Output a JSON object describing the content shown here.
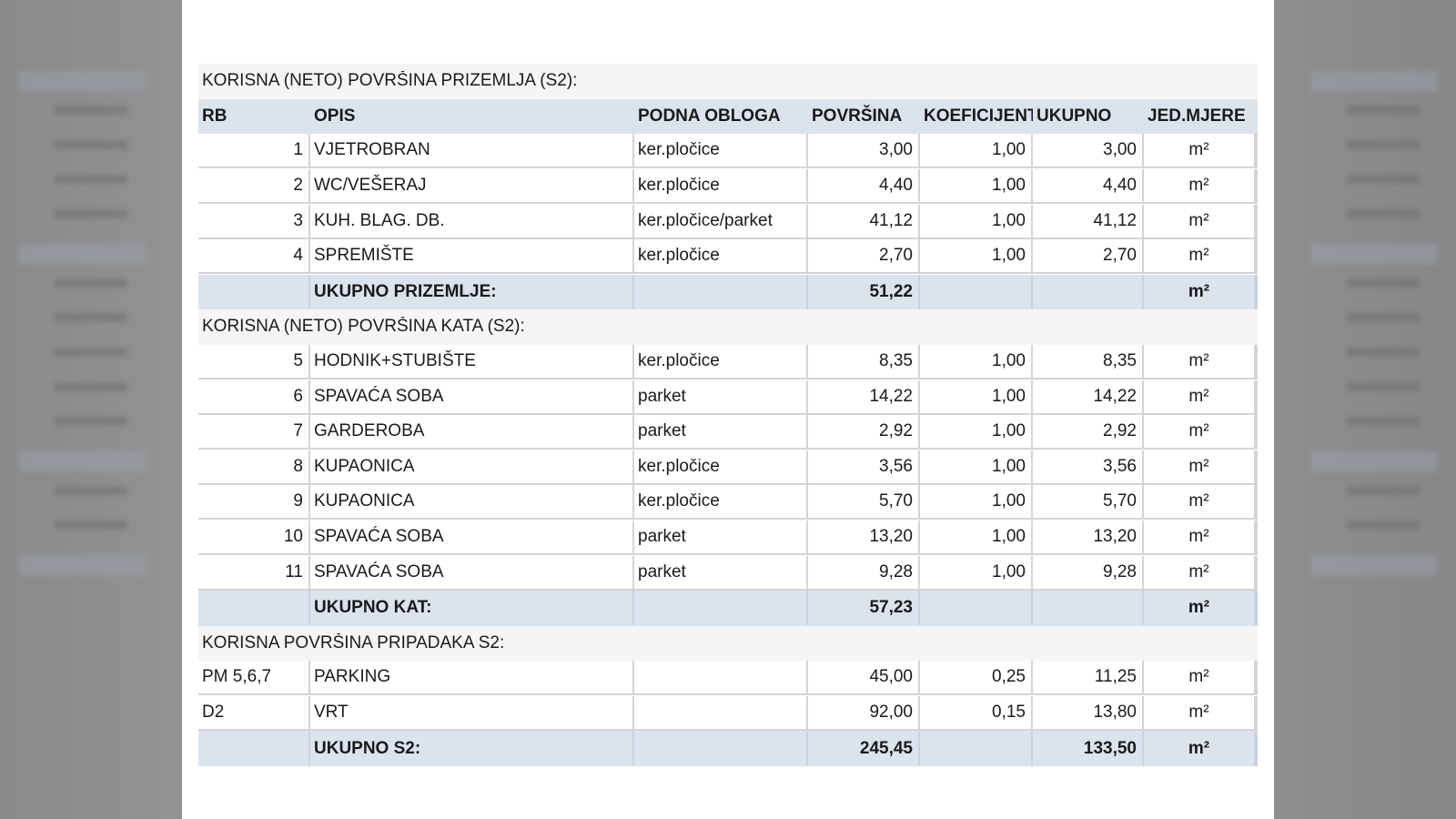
{
  "header": [
    "RB",
    "OPIS",
    "PODNA OBLOGA",
    "POVRŠINA",
    "KOEFICIJENT",
    "UKUPNO",
    "JED.MJERE"
  ],
  "unit": "m²",
  "sections": [
    {
      "title": "KORISNA (NETO) POVRŠINA PRIZEMLJA (S2):",
      "rows": [
        {
          "rb": "1",
          "opis": "VJETROBRAN",
          "obloga": "ker.pločice",
          "povrsina": "3,00",
          "koef": "1,00",
          "ukupno": "3,00"
        },
        {
          "rb": "2",
          "opis": "WC/VEŠERAJ",
          "obloga": "ker.pločice",
          "povrsina": "4,40",
          "koef": "1,00",
          "ukupno": "4,40"
        },
        {
          "rb": "3",
          "opis": "KUH. BLAG. DB.",
          "obloga": "ker.pločice/parket",
          "povrsina": "41,12",
          "koef": "1,00",
          "ukupno": "41,12"
        },
        {
          "rb": "4",
          "opis": "SPREMIŠTE",
          "obloga": "ker.pločice",
          "povrsina": "2,70",
          "koef": "1,00",
          "ukupno": "2,70"
        }
      ],
      "total": {
        "label": "UKUPNO PRIZEMLJE:",
        "povrsina": "51,22",
        "ukupno": ""
      }
    },
    {
      "title": "KORISNA (NETO) POVRŠINA KATA (S2):",
      "rows": [
        {
          "rb": "5",
          "opis": "HODNIK+STUBIŠTE",
          "obloga": "ker.pločice",
          "povrsina": "8,35",
          "koef": "1,00",
          "ukupno": "8,35"
        },
        {
          "rb": "6",
          "opis": "SPAVAĆA SOBA",
          "obloga": "parket",
          "povrsina": "14,22",
          "koef": "1,00",
          "ukupno": "14,22"
        },
        {
          "rb": "7",
          "opis": "GARDEROBA",
          "obloga": "parket",
          "povrsina": "2,92",
          "koef": "1,00",
          "ukupno": "2,92"
        },
        {
          "rb": "8",
          "opis": "KUPAONICA",
          "obloga": "ker.pločice",
          "povrsina": "3,56",
          "koef": "1,00",
          "ukupno": "3,56"
        },
        {
          "rb": "9",
          "opis": "KUPAONICA",
          "obloga": "ker.pločice",
          "povrsina": "5,70",
          "koef": "1,00",
          "ukupno": "5,70"
        },
        {
          "rb": "10",
          "opis": "SPAVAĆA SOBA",
          "obloga": "parket",
          "povrsina": "13,20",
          "koef": "1,00",
          "ukupno": "13,20"
        },
        {
          "rb": "11",
          "opis": "SPAVAĆA SOBA",
          "obloga": "parket",
          "povrsina": "9,28",
          "koef": "1,00",
          "ukupno": "9,28"
        }
      ],
      "total": {
        "label": "UKUPNO KAT:",
        "povrsina": "57,23",
        "ukupno": ""
      }
    },
    {
      "title": "KORISNA POVRŠINA PRIPADAKA S2:",
      "rows": [
        {
          "rb": "PM 5,6,7",
          "opis": "PARKING",
          "obloga": "",
          "povrsina": "45,00",
          "koef": "0,25",
          "ukupno": "11,25",
          "leftRb": true
        },
        {
          "rb": "D2",
          "opis": "VRT",
          "obloga": "",
          "povrsina": "92,00",
          "koef": "0,15",
          "ukupno": "13,80",
          "leftRb": true
        }
      ],
      "total": {
        "label": "UKUPNO S2:",
        "povrsina": "245,45",
        "ukupno": "133,50"
      }
    }
  ]
}
